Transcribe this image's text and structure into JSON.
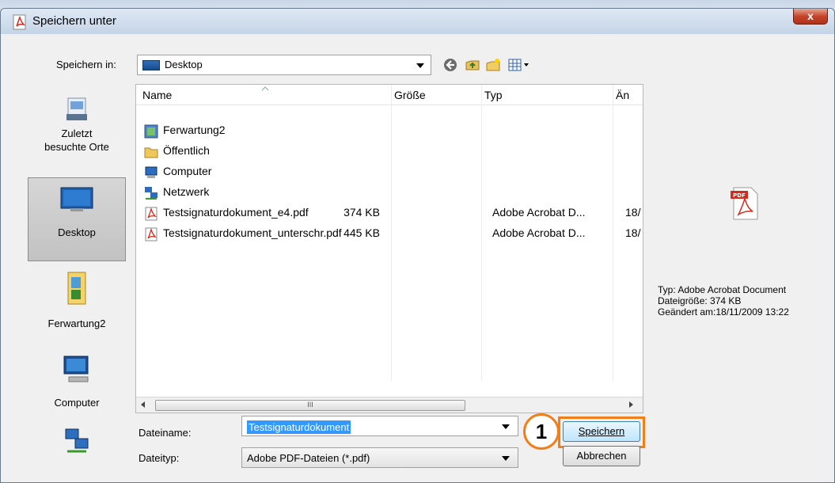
{
  "window": {
    "title": "Speichern unter",
    "close_label": "x"
  },
  "toolbar": {
    "save_in_label": "Speichern in:",
    "save_in_value": "Desktop",
    "icons": [
      "back-icon",
      "up-folder-icon",
      "new-folder-icon",
      "view-menu-icon"
    ]
  },
  "places": [
    {
      "label_line1": "Zuletzt",
      "label_line2": "besuchte Orte",
      "icon": "recent-places-icon"
    },
    {
      "label_line1": "Desktop",
      "label_line2": "",
      "icon": "desktop-icon"
    },
    {
      "label_line1": "Ferwartung2",
      "label_line2": "",
      "icon": "user-folder-icon"
    },
    {
      "label_line1": "Computer",
      "label_line2": "",
      "icon": "computer-icon"
    },
    {
      "label_line1": "",
      "label_line2": "",
      "icon": "network-icon"
    }
  ],
  "columns": {
    "name": "Name",
    "size": "Größe",
    "type": "Typ",
    "modified": "Än"
  },
  "files": [
    {
      "name": "Ferwartung2",
      "size": "",
      "type": "",
      "modified": "",
      "icon": "user-folder-icon"
    },
    {
      "name": "Öffentlich",
      "size": "",
      "type": "",
      "modified": "",
      "icon": "folder-icon"
    },
    {
      "name": "Computer",
      "size": "",
      "type": "",
      "modified": "",
      "icon": "computer-icon"
    },
    {
      "name": "Netzwerk",
      "size": "",
      "type": "",
      "modified": "",
      "icon": "network-icon"
    },
    {
      "name": "Testsignaturdokument_e4.pdf",
      "size": "374 KB",
      "type": "Adobe Acrobat D...",
      "modified": "18/",
      "icon": "pdf-icon"
    },
    {
      "name": "Testsignaturdokument_unterschr.pdf",
      "size": "445 KB",
      "type": "Adobe Acrobat D...",
      "modified": "18/",
      "icon": "pdf-icon"
    }
  ],
  "scrollbar": {
    "grip": "III"
  },
  "preview": {
    "type_line": "Typ: Adobe Acrobat Document",
    "size_line": "Dateigröße: 374 KB",
    "modified_line": "Geändert am:18/11/2009 13:22"
  },
  "form": {
    "filename_label": "Dateiname:",
    "filename_value": "Testsignaturdokument",
    "filetype_label": "Dateityp:",
    "filetype_value": "Adobe PDF-Dateien (*.pdf)",
    "save_button": "Speichern",
    "cancel_button": "Abbrechen"
  },
  "annotation": {
    "callout_number": "1",
    "accent_color": "#f07f1a"
  }
}
